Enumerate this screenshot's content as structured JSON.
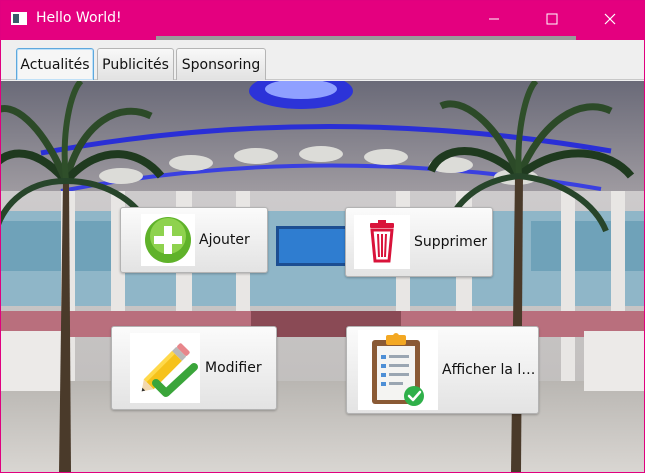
{
  "window": {
    "title": "Hello World!",
    "accent": "#e4007f"
  },
  "tabs": [
    {
      "label": "Actualités",
      "active": true
    },
    {
      "label": "Publicités",
      "active": false
    },
    {
      "label": "Sponsoring",
      "active": false
    }
  ],
  "actions": {
    "add": {
      "label": "Ajouter",
      "icon": "plus-icon"
    },
    "delete": {
      "label": "Supprimer",
      "icon": "trash-icon"
    },
    "edit": {
      "label": "Modifier",
      "icon": "pencil-icon"
    },
    "list": {
      "label": "Afficher la li...",
      "icon": "clipboard-check-icon"
    }
  },
  "background": {
    "scene": "mall-interior-photo"
  }
}
